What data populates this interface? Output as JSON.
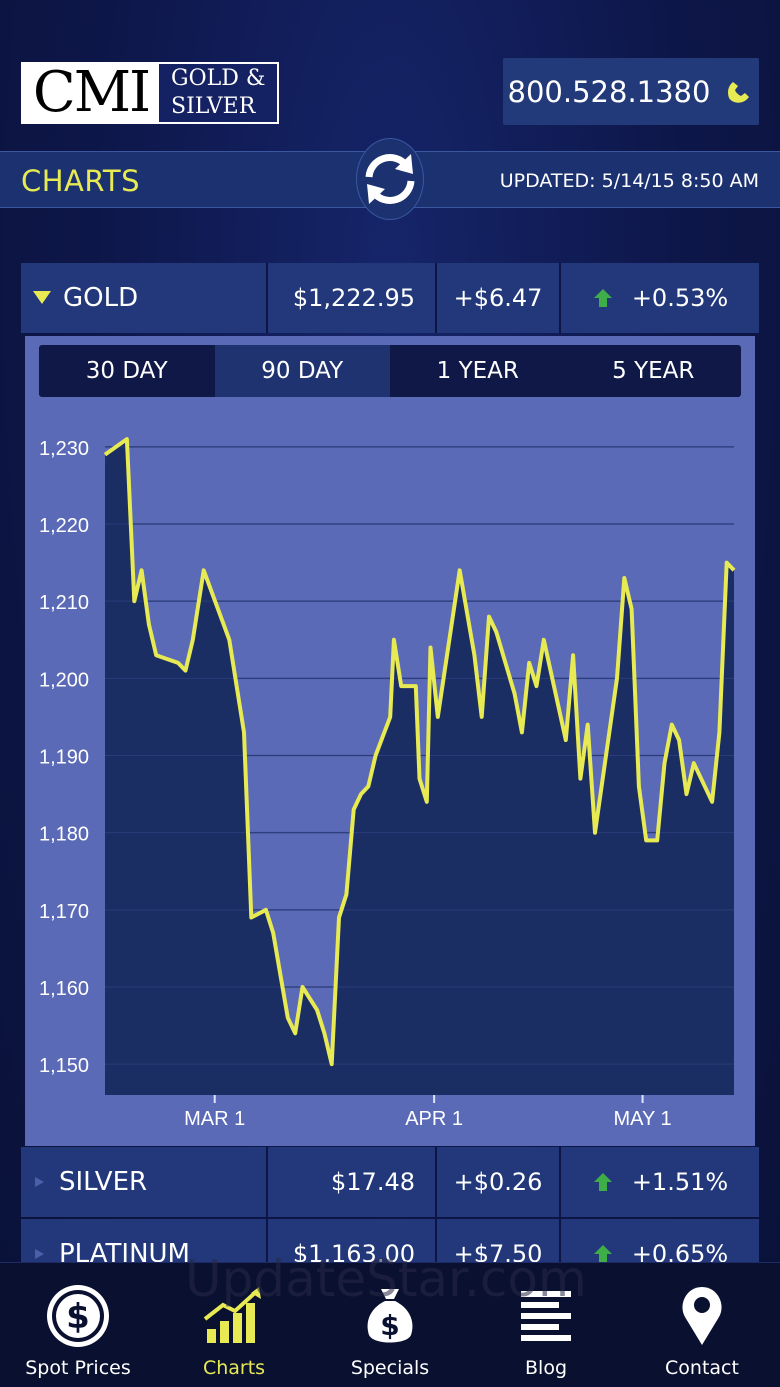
{
  "header": {
    "logo_cmi": "CMI",
    "logo_line1": "GOLD &",
    "logo_line2": "SILVER",
    "phone": "800.528.1380",
    "phone_icon": "phone-icon"
  },
  "section": {
    "title": "CHARTS",
    "updated": "UPDATED: 5/14/15 8:50 AM",
    "refresh_icon": "refresh-icon"
  },
  "metals": [
    {
      "name": "GOLD",
      "price": "$1,222.95",
      "change": "+$6.47",
      "pct": "+0.53%",
      "expanded": true
    },
    {
      "name": "SILVER",
      "price": "$17.48",
      "change": "+$0.26",
      "pct": "+1.51%",
      "expanded": false
    },
    {
      "name": "PLATINUM",
      "price": "$1,163.00",
      "change": "+$7.50",
      "pct": "+0.65%",
      "expanded": false
    }
  ],
  "range_tabs": [
    {
      "label": "30 DAY",
      "active": false
    },
    {
      "label": "90 DAY",
      "active": true
    },
    {
      "label": "1 YEAR",
      "active": false
    },
    {
      "label": "5 YEAR",
      "active": false
    }
  ],
  "colors": {
    "accent": "#e7ea52",
    "up_arrow": "#3fae49",
    "chart_fill": "#1a2e63",
    "chart_bg": "#5b6ab6"
  },
  "chart_data": {
    "type": "area",
    "title": "",
    "xlabel": "",
    "ylabel": "",
    "ylim": [
      1146,
      1234
    ],
    "xlim": [
      0,
      86
    ],
    "yticks": [
      1230,
      1220,
      1210,
      1200,
      1190,
      1180,
      1170,
      1160,
      1150
    ],
    "ytick_labels": [
      "1,230",
      "1,220",
      "1,210",
      "1,200",
      "1,190",
      "1,180",
      "1,170",
      "1,160",
      "1,150"
    ],
    "xticks": [
      15,
      45,
      73.5
    ],
    "xtick_labels": [
      "MAR 1",
      "APR 1",
      "MAY 1"
    ],
    "grid": true,
    "series": [
      {
        "values": [
          [
            0,
            1229
          ],
          [
            3,
            1231
          ],
          [
            4,
            1210
          ],
          [
            5,
            1214
          ],
          [
            6,
            1207
          ],
          [
            7,
            1203
          ],
          [
            10,
            1202
          ],
          [
            11,
            1201
          ],
          [
            12,
            1205
          ],
          [
            13.5,
            1214
          ],
          [
            17,
            1205
          ],
          [
            19,
            1193
          ],
          [
            20,
            1169
          ],
          [
            22,
            1170
          ],
          [
            23,
            1167
          ],
          [
            25,
            1156
          ],
          [
            26,
            1154
          ],
          [
            27,
            1160
          ],
          [
            29,
            1157
          ],
          [
            30,
            1154
          ],
          [
            31,
            1150
          ],
          [
            32,
            1169
          ],
          [
            33,
            1172
          ],
          [
            34,
            1183
          ],
          [
            35,
            1185
          ],
          [
            36,
            1186
          ],
          [
            37,
            1190
          ],
          [
            39,
            1195
          ],
          [
            39.5,
            1205
          ],
          [
            40.5,
            1199
          ],
          [
            42.5,
            1199
          ],
          [
            43,
            1187
          ],
          [
            44,
            1184
          ],
          [
            44.5,
            1204
          ],
          [
            45.5,
            1195
          ],
          [
            48.5,
            1214
          ],
          [
            50.5,
            1203
          ],
          [
            51.5,
            1195
          ],
          [
            52.5,
            1208
          ],
          [
            53.5,
            1206
          ],
          [
            56,
            1198
          ],
          [
            57,
            1193
          ],
          [
            58,
            1202
          ],
          [
            59,
            1199
          ],
          [
            60,
            1205
          ],
          [
            63,
            1192
          ],
          [
            64,
            1203
          ],
          [
            65,
            1187
          ],
          [
            66,
            1194
          ],
          [
            67,
            1180
          ],
          [
            70,
            1200
          ],
          [
            71,
            1213
          ],
          [
            72,
            1209
          ],
          [
            73,
            1186
          ],
          [
            74,
            1179
          ],
          [
            75.5,
            1179
          ],
          [
            76.5,
            1189
          ],
          [
            77.5,
            1194
          ],
          [
            78.5,
            1192
          ],
          [
            79.5,
            1185
          ],
          [
            80.5,
            1189
          ],
          [
            83,
            1184
          ],
          [
            84,
            1193
          ],
          [
            85,
            1215
          ],
          [
            86,
            1214
          ]
        ]
      }
    ]
  },
  "nav": [
    {
      "label": "Spot Prices",
      "icon": "dollar-circle-icon",
      "active": false
    },
    {
      "label": "Charts",
      "icon": "bar-chart-icon",
      "active": true
    },
    {
      "label": "Specials",
      "icon": "money-bag-icon",
      "active": false
    },
    {
      "label": "Blog",
      "icon": "lines-icon",
      "active": false
    },
    {
      "label": "Contact",
      "icon": "map-pin-icon",
      "active": false
    }
  ],
  "watermark": "UpdateStar.com"
}
